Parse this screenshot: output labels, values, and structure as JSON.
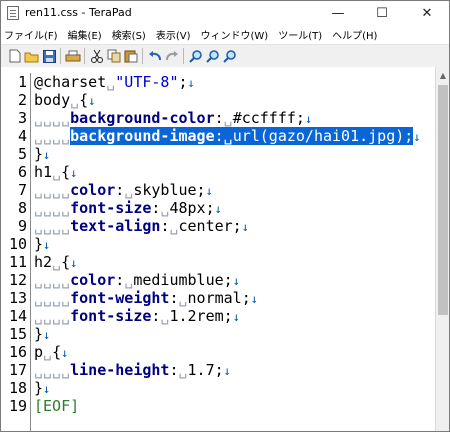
{
  "window": {
    "title": "ren11.css - TeraPad"
  },
  "titlebar": {
    "minimize": "—",
    "maximize": "☐",
    "close": "✕"
  },
  "menu": [
    "ファイル(F)",
    "編集(E)",
    "検索(S)",
    "表示(V)",
    "ウィンドウ(W)",
    "ツール(T)",
    "ヘルプ(H)"
  ],
  "toolbar": {
    "icons": [
      "new-file-icon",
      "open-folder-icon",
      "save-icon",
      "print-icon",
      "cut-icon",
      "copy-icon",
      "paste-icon",
      "undo-icon",
      "redo-icon",
      "find-icon",
      "find-next-icon",
      "find-prev-icon"
    ]
  },
  "editor": {
    "line_numbers": [
      "1",
      "2",
      "3",
      "4",
      "5",
      "6",
      "7",
      "8",
      "9",
      "10",
      "11",
      "12",
      "13",
      "14",
      "15",
      "16",
      "17",
      "18",
      "19"
    ],
    "l1": {
      "a": "@charset",
      "b": "\"UTF-8\"",
      "c": ";"
    },
    "l2": {
      "a": "body",
      "b": "{"
    },
    "l3": {
      "a": "background-color",
      "b": ":",
      "c": "#ccffff;"
    },
    "l4": {
      "a": "background-image",
      "b": ":",
      "c": "url(gazo/hai01.jpg);"
    },
    "l5": {
      "a": "}"
    },
    "l6": {
      "a": "h1",
      "b": "{"
    },
    "l7": {
      "a": "color",
      "b": ":",
      "c": "skyblue;"
    },
    "l8": {
      "a": "font-size",
      "b": ":",
      "c": "48px;"
    },
    "l9": {
      "a": "text-align",
      "b": ":",
      "c": "center;"
    },
    "l10": {
      "a": "}"
    },
    "l11": {
      "a": "h2",
      "b": "{"
    },
    "l12": {
      "a": "color",
      "b": ":",
      "c": "mediumblue;"
    },
    "l13": {
      "a": "font-weight",
      "b": ":",
      "c": "normal;"
    },
    "l14": {
      "a": "font-size",
      "b": ":",
      "c": "1.2rem;"
    },
    "l15": {
      "a": "}"
    },
    "l16": {
      "a": "p",
      "b": "{"
    },
    "l17": {
      "a": "line-height",
      "b": ":",
      "c": "1.7;"
    },
    "l18": {
      "a": "}"
    },
    "l19": {
      "a": "[EOF]"
    },
    "marks": {
      "return": "↓",
      "indent": "␣␣␣␣",
      "space": "␣"
    }
  },
  "colors": {
    "selection": "#0a66d6",
    "keyword": "#000080",
    "string": "#0000cc",
    "eof": "#2f7d2f"
  }
}
